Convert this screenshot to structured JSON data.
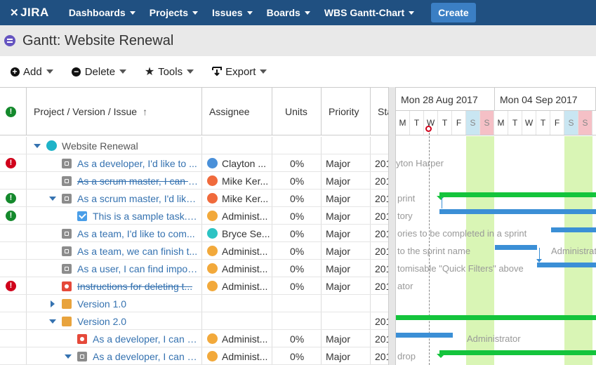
{
  "nav": {
    "logo": "JIRA",
    "items": [
      {
        "label": "Dashboards"
      },
      {
        "label": "Projects"
      },
      {
        "label": "Issues"
      },
      {
        "label": "Boards"
      },
      {
        "label": "WBS Gantt-Chart"
      }
    ],
    "create": "Create"
  },
  "page": {
    "title": "Gantt:  Website Renewal"
  },
  "toolbar": {
    "add": "Add",
    "delete": "Delete",
    "tools": "Tools",
    "export": "Export"
  },
  "columns": {
    "project": "Project / Version / Issue",
    "sort_arrow": "↑",
    "assignee": "Assignee",
    "units": "Units",
    "priority": "Priority",
    "start": "Sta"
  },
  "rows": [
    {
      "flag": "",
      "summary": "Website Renewal",
      "assignee": "",
      "units": "",
      "priority": "",
      "start": ""
    },
    {
      "flag": "!",
      "summary": "As a developer, I'd like to ...",
      "assignee": "Clayton ...",
      "units": "0%",
      "priority": "Major",
      "start": "201"
    },
    {
      "flag": "",
      "summary": "As a scrum master, I can s...",
      "assignee": "Mike Ker...",
      "units": "0%",
      "priority": "Major",
      "start": "201"
    },
    {
      "flag": "!",
      "summary": "As a scrum master, I'd like ...",
      "assignee": "Mike Ker...",
      "units": "0%",
      "priority": "Major",
      "start": "201"
    },
    {
      "flag": "!",
      "summary": "This is a sample task. T...",
      "assignee": "Administ...",
      "units": "0%",
      "priority": "Major",
      "start": "201"
    },
    {
      "flag": "",
      "summary": "As a team, I'd like to com...",
      "assignee": "Bryce Se...",
      "units": "0%",
      "priority": "Major",
      "start": "201"
    },
    {
      "flag": "",
      "summary": "As a team, we can finish t...",
      "assignee": "Administ...",
      "units": "0%",
      "priority": "Major",
      "start": "201"
    },
    {
      "flag": "",
      "summary": "As a user, I can find impor...",
      "assignee": "Administ...",
      "units": "0%",
      "priority": "Major",
      "start": "201"
    },
    {
      "flag": "!",
      "summary": "Instructions for deleting t...",
      "assignee": "Administ...",
      "units": "0%",
      "priority": "Major",
      "start": "201"
    },
    {
      "flag": "",
      "summary": "Version 1.0",
      "assignee": "",
      "units": "",
      "priority": "",
      "start": ""
    },
    {
      "flag": "",
      "summary": "Version 2.0",
      "assignee": "",
      "units": "",
      "priority": "",
      "start": "201"
    },
    {
      "flag": "",
      "summary": "As a developer, I can u...",
      "assignee": "Administ...",
      "units": "0%",
      "priority": "Major",
      "start": "201"
    },
    {
      "flag": "",
      "summary": "As a developer, I can u...",
      "assignee": "Administ...",
      "units": "0%",
      "priority": "Major",
      "start": "201"
    }
  ],
  "gantt": {
    "weeks": [
      "Mon 28 Aug 2017",
      "Mon 04 Sep 2017"
    ],
    "days": [
      "M",
      "T",
      "W",
      "T",
      "F",
      "S",
      "S",
      "M",
      "T",
      "W",
      "T",
      "F",
      "S",
      "S"
    ],
    "labels": [
      "yton Harper",
      "print",
      "tory",
      "ories to be completed in a sprint",
      "to the sprint name",
      "Administrat",
      "tomisable \"Quick Filters\" above",
      "ator",
      "Administrator",
      "drop"
    ]
  }
}
